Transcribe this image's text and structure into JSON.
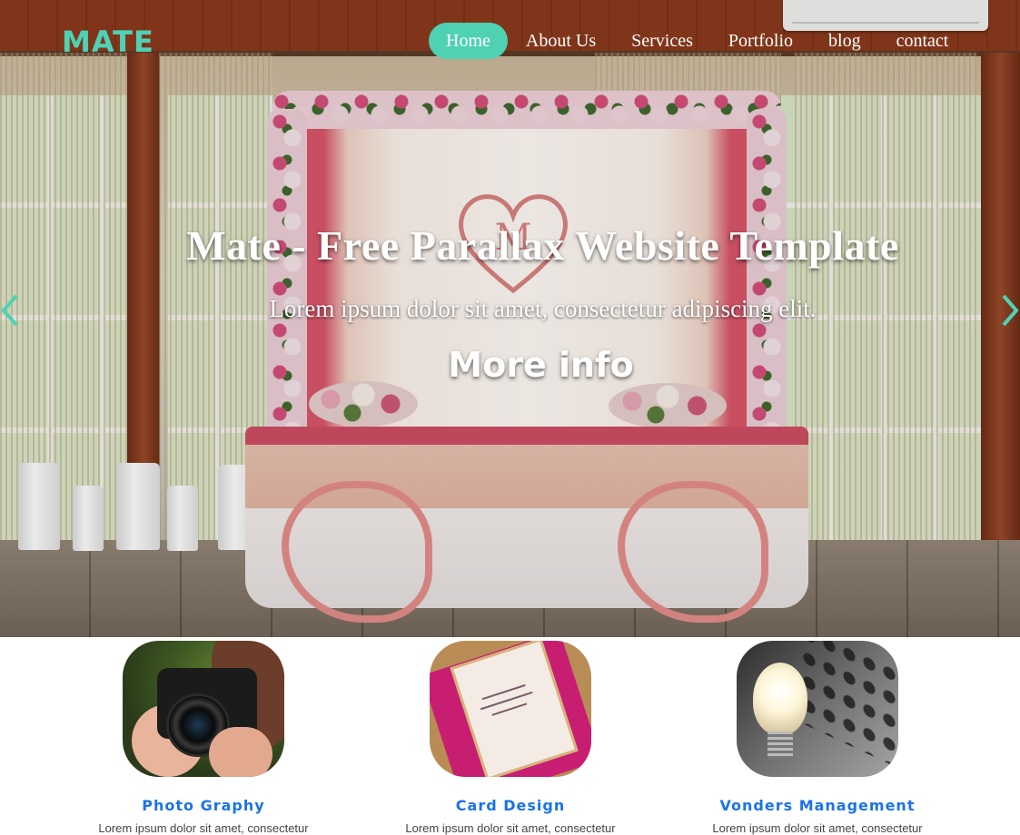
{
  "brand": {
    "logo": "MATE",
    "accent": "#4fd1b4"
  },
  "nav": {
    "items": [
      {
        "label": "Home",
        "active": true
      },
      {
        "label": "About Us",
        "active": false
      },
      {
        "label": "Services",
        "active": false
      },
      {
        "label": "Portfolio",
        "active": false
      },
      {
        "label": "blog",
        "active": false
      },
      {
        "label": "contact",
        "active": false
      }
    ]
  },
  "hero": {
    "title": "Mate - Free Parallax Website Template",
    "subtitle": "Lorem ipsum dolor sit amet, consectetur adipiscing elit.",
    "cta": "More info",
    "prev_icon": "chevron-left-icon",
    "next_icon": "chevron-right-icon"
  },
  "services": {
    "title_color": "#1a73e8",
    "items": [
      {
        "title": "Photo Graphy",
        "text": "Lorem ipsum dolor sit amet, consectetur",
        "image": "camera-photo"
      },
      {
        "title": "Card Design",
        "text": "Lorem ipsum dolor sit amet, consectetur",
        "image": "invitation-card-photo"
      },
      {
        "title": "Vonders Management",
        "text": "Lorem ipsum dolor sit amet, consectetur",
        "image": "light-bulb-photo"
      }
    ]
  }
}
